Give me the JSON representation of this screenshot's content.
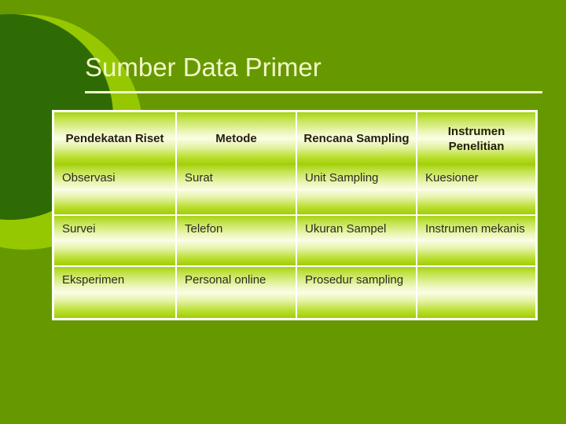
{
  "slide": {
    "title": "Sumber Data Primer",
    "background_color": "#669900",
    "title_color": "#f2f7c8",
    "decoration": {
      "dark_circle_color": "#2f6b05",
      "light_circle_color": "#95c800"
    }
  },
  "table": {
    "headers": [
      "Pendekatan Riset",
      "Metode",
      "Rencana Sampling",
      "Instrumen Penelitian"
    ],
    "rows": [
      {
        "pendekatan_riset": "Observasi",
        "metode": "Surat",
        "rencana_sampling": "Unit Sampling",
        "instrumen_penelitian": "Kuesioner"
      },
      {
        "pendekatan_riset": "Survei",
        "metode": "Telefon",
        "rencana_sampling": "Ukuran Sampel",
        "instrumen_penelitian": "Instrumen mekanis"
      },
      {
        "pendekatan_riset": "Eksperimen",
        "metode": "Personal online",
        "rencana_sampling": "Prosedur sampling",
        "instrumen_penelitian": ""
      }
    ]
  }
}
